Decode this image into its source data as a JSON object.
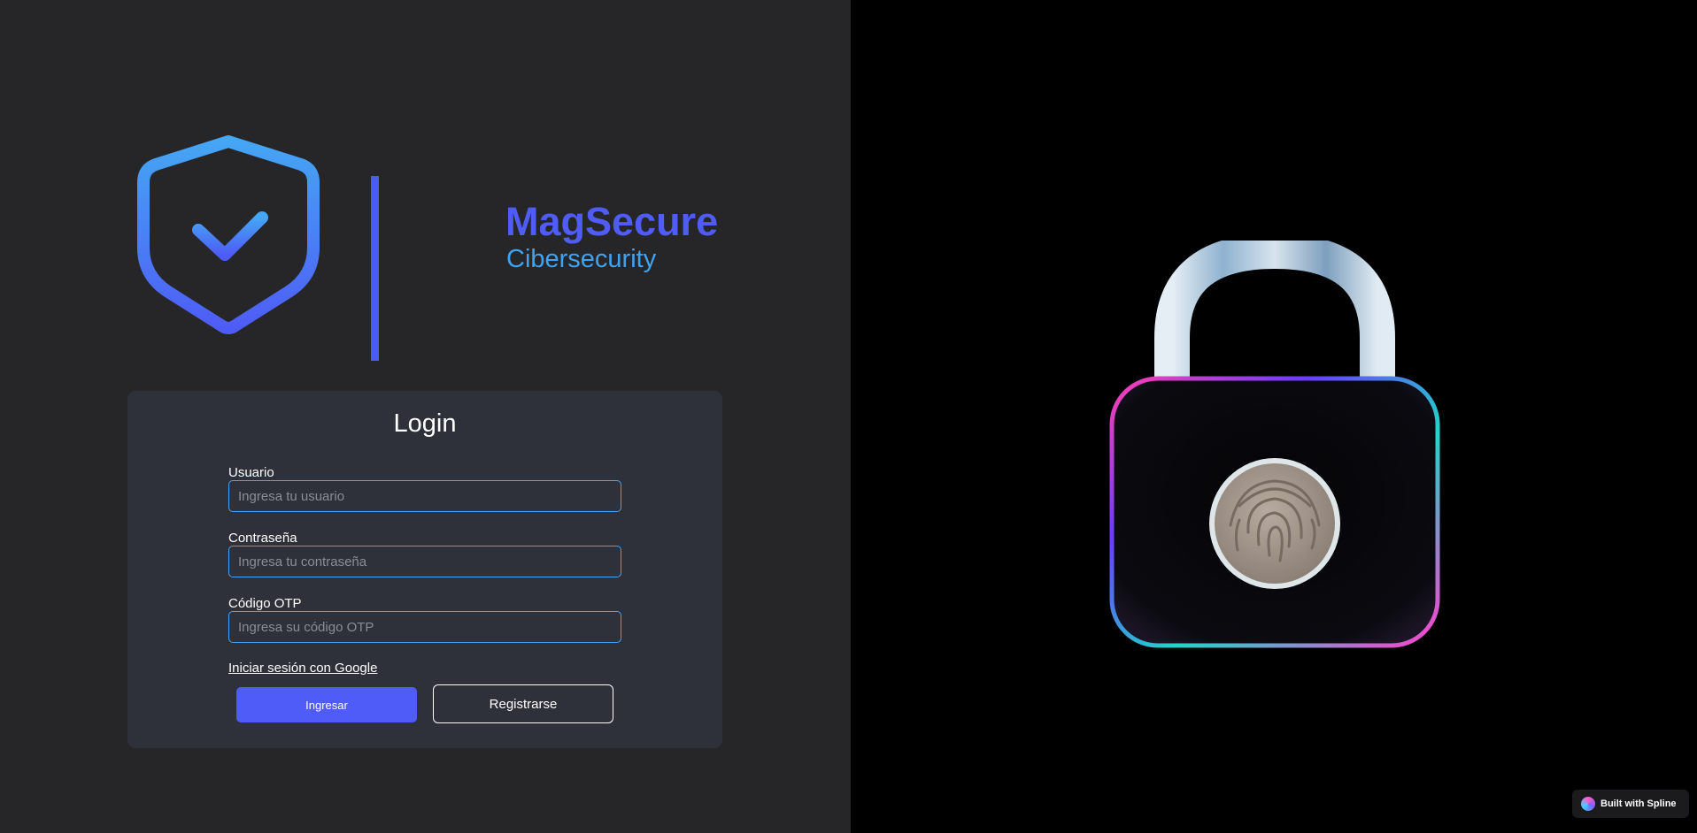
{
  "brand": {
    "name": "MagSecure",
    "tagline": "Cibersecurity"
  },
  "login": {
    "title": "Login",
    "fields": [
      {
        "label": "Usuario",
        "placeholder": "Ingresa tu usuario",
        "value": ""
      },
      {
        "label": "Contraseña",
        "placeholder": "Ingresa tu contraseña",
        "value": ""
      },
      {
        "label": "Código OTP",
        "placeholder": "Ingresa su código OTP",
        "value": ""
      }
    ],
    "google_link": "Iniciar sesión con Google",
    "submit_label": "Ingresar",
    "register_label": "Registrarse"
  },
  "hero": {
    "icon": "padlock-fingerprint-icon"
  },
  "badge": {
    "label": "Built with Spline",
    "icon": "spline-logo-icon"
  },
  "colors": {
    "left_background": "#262629",
    "right_background": "#000000",
    "card_background": "#2e313a",
    "accent_primary": "#4f5cf7",
    "accent_secondary": "#3fa3f4",
    "input_border": "#4aa3f2"
  }
}
